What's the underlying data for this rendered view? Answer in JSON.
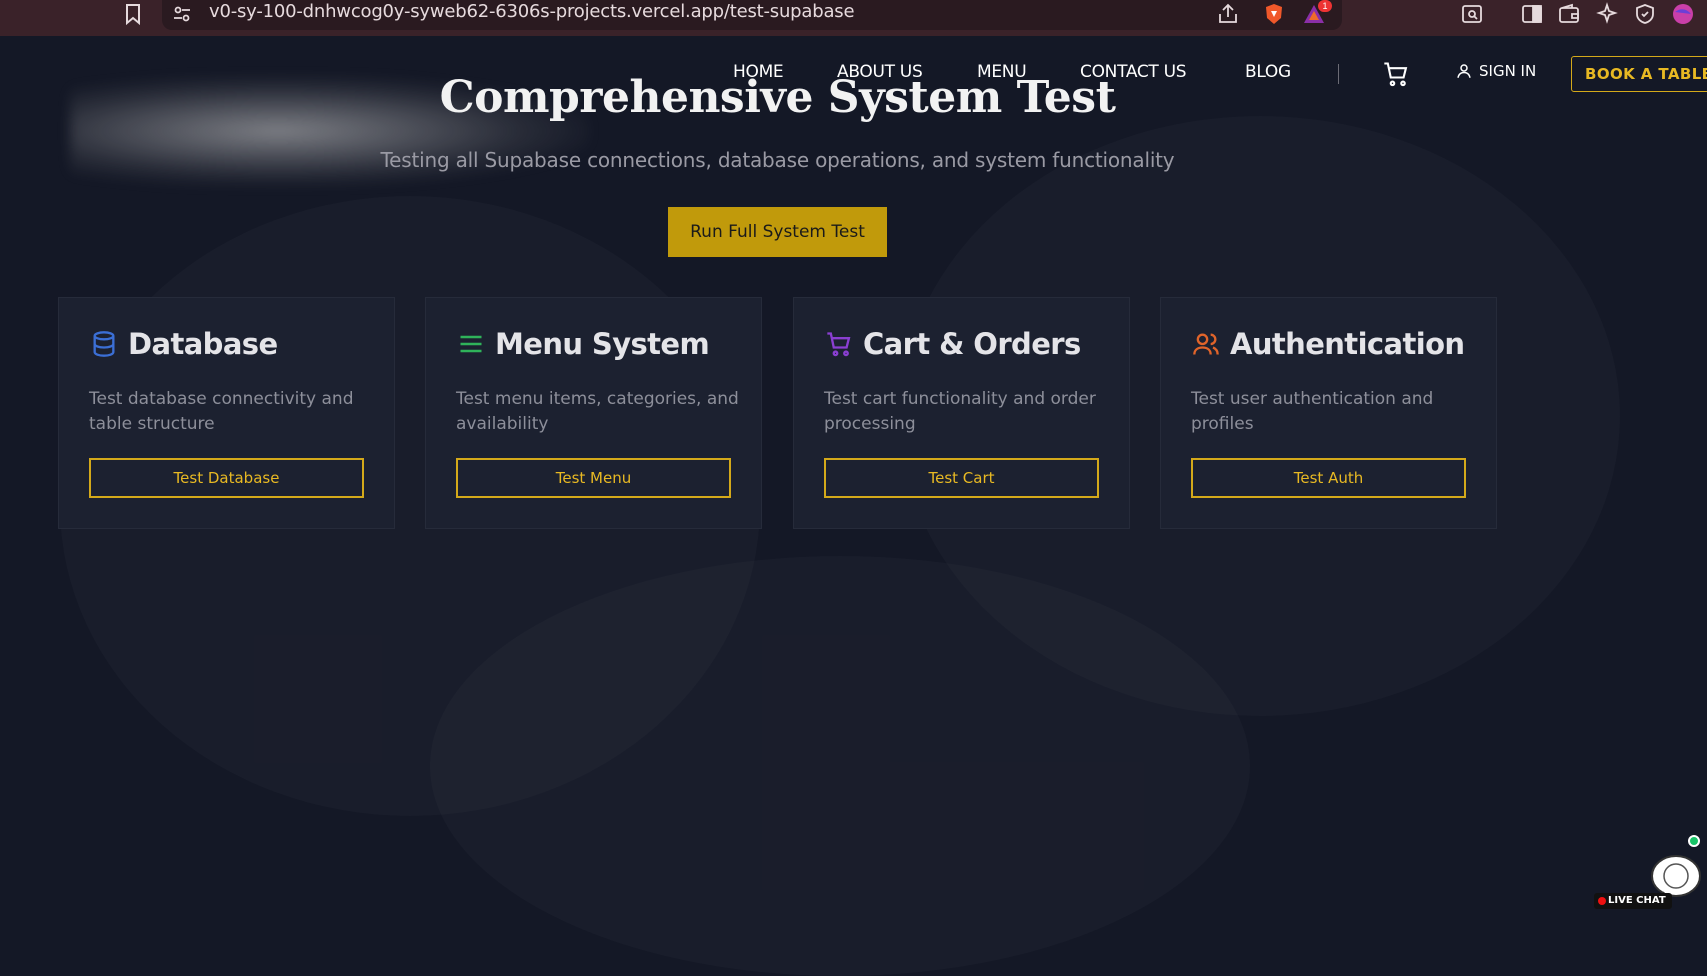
{
  "browser": {
    "url": "v0-sy-100-dnhwcog0y-syweb62-6306s-projects.vercel.app/test-supabase",
    "notification_count": "1"
  },
  "nav": {
    "items": [
      "HOME",
      "ABOUT US",
      "MENU",
      "CONTACT US",
      "BLOG"
    ],
    "sign_in": "SIGN IN",
    "book": "BOOK A TABLE"
  },
  "hero": {
    "title": "Comprehensive System Test",
    "subtitle": "Testing all Supabase connections, database operations, and system functionality",
    "run_button": "Run Full System Test"
  },
  "cards": [
    {
      "title": "Database",
      "desc": "Test database connectivity and table structure",
      "button": "Test Database",
      "icon": "database-icon",
      "color": "#3b6fd6"
    },
    {
      "title": "Menu System",
      "desc": "Test menu items, categories, and availability",
      "button": "Test Menu",
      "icon": "list-icon",
      "color": "#2fb35a"
    },
    {
      "title": "Cart & Orders",
      "desc": "Test cart functionality and order processing",
      "button": "Test Cart",
      "icon": "cart-icon",
      "color": "#8a3fd1"
    },
    {
      "title": "Authentication",
      "desc": "Test user authentication and profiles",
      "button": "Test Auth",
      "icon": "users-icon",
      "color": "#e0642a"
    }
  ],
  "live_chat": {
    "label": "LIVE CHAT"
  },
  "colors": {
    "accent": "#d4a91a",
    "background": "#141826",
    "card": "#1c2130"
  }
}
